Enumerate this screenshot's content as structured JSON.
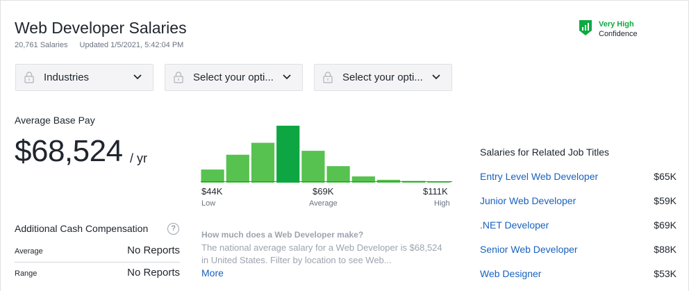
{
  "header": {
    "title": "Web Developer Salaries",
    "salary_count": "20,761 Salaries",
    "updated": "Updated 1/5/2021, 5:42:04 PM"
  },
  "confidence": {
    "level": "Very High",
    "label": "Confidence",
    "color": "#0caa41"
  },
  "filters": [
    {
      "label": "Industries",
      "locked": true
    },
    {
      "label": "Select your opti...",
      "locked": true
    },
    {
      "label": "Select your opti...",
      "locked": true
    }
  ],
  "base_pay": {
    "label": "Average Base Pay",
    "value": "$68,524",
    "unit": "/ yr"
  },
  "cash_comp": {
    "label": "Additional Cash Compensation",
    "help": "?",
    "rows": [
      {
        "label": "Average",
        "value": "No Reports"
      },
      {
        "label": "Range",
        "value": "No Reports"
      }
    ]
  },
  "chart_data": {
    "type": "bar",
    "relative_heights": [
      0.23,
      0.49,
      0.7,
      1.0,
      0.56,
      0.29,
      0.11,
      0.05,
      0.03,
      0.02
    ],
    "highlight_index": 3,
    "colors": {
      "bar": "#57c24f",
      "highlight": "#0ea642"
    },
    "ticks": [
      {
        "value": "$44K",
        "sub": "Low"
      },
      {
        "value": "$69K",
        "sub": "Average"
      },
      {
        "value": "$111K",
        "sub": "High"
      }
    ]
  },
  "howmuch": {
    "question": "How much does a Web Developer make?",
    "answer": "The national average salary for a Web Developer is $68,524 in United States. Filter by location to see Web...",
    "more": "More"
  },
  "related": {
    "title": "Salaries for Related Job Titles",
    "items": [
      {
        "name": "Entry Level Web Developer",
        "pay": "$65K"
      },
      {
        "name": "Junior Web Developer",
        "pay": "$59K"
      },
      {
        "name": ".NET Developer",
        "pay": "$69K"
      },
      {
        "name": "Senior Web Developer",
        "pay": "$88K"
      },
      {
        "name": "Web Designer",
        "pay": "$53K"
      }
    ]
  }
}
